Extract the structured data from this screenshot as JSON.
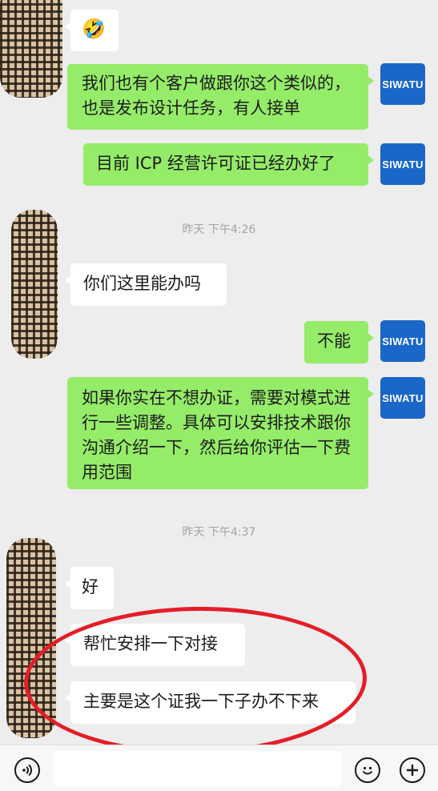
{
  "messages": [
    {
      "id": "m1",
      "side": "other",
      "emoji": "🤣"
    },
    {
      "id": "m2",
      "side": "me",
      "text": "我们也有个客户做跟你这个类似的，也是发布设计任务，有人接单"
    },
    {
      "id": "m3",
      "side": "me",
      "text": "目前 ICP 经营许可证已经办好了"
    },
    {
      "id": "m4",
      "side": "other",
      "text": "你们这里能办吗"
    },
    {
      "id": "m5",
      "side": "me",
      "text": "不能"
    },
    {
      "id": "m6",
      "side": "me",
      "text": "如果你实在不想办证，需要对模式进行一些调整。具体可以安排技术跟你沟通介绍一下，然后给你评估一下费用范围"
    },
    {
      "id": "m7",
      "side": "other",
      "text": "好"
    },
    {
      "id": "m8",
      "side": "other",
      "text": "帮忙安排一下对接"
    },
    {
      "id": "m9",
      "side": "other",
      "text": "主要是这个证我一下子办不下来"
    }
  ],
  "timestamps": [
    "昨天 下午4:26",
    "昨天 下午4:37"
  ],
  "my_avatar_text": "SIWATU",
  "icons": {
    "voice": "voice-icon",
    "emoji": "emoji-face-icon",
    "plus": "plus-icon"
  },
  "colors": {
    "my_bubble": "#95ec69",
    "other_bubble": "#ffffff",
    "background": "#ededed",
    "avatar_brand": "#1a67c8",
    "annotation_circle": "#e41d28"
  }
}
